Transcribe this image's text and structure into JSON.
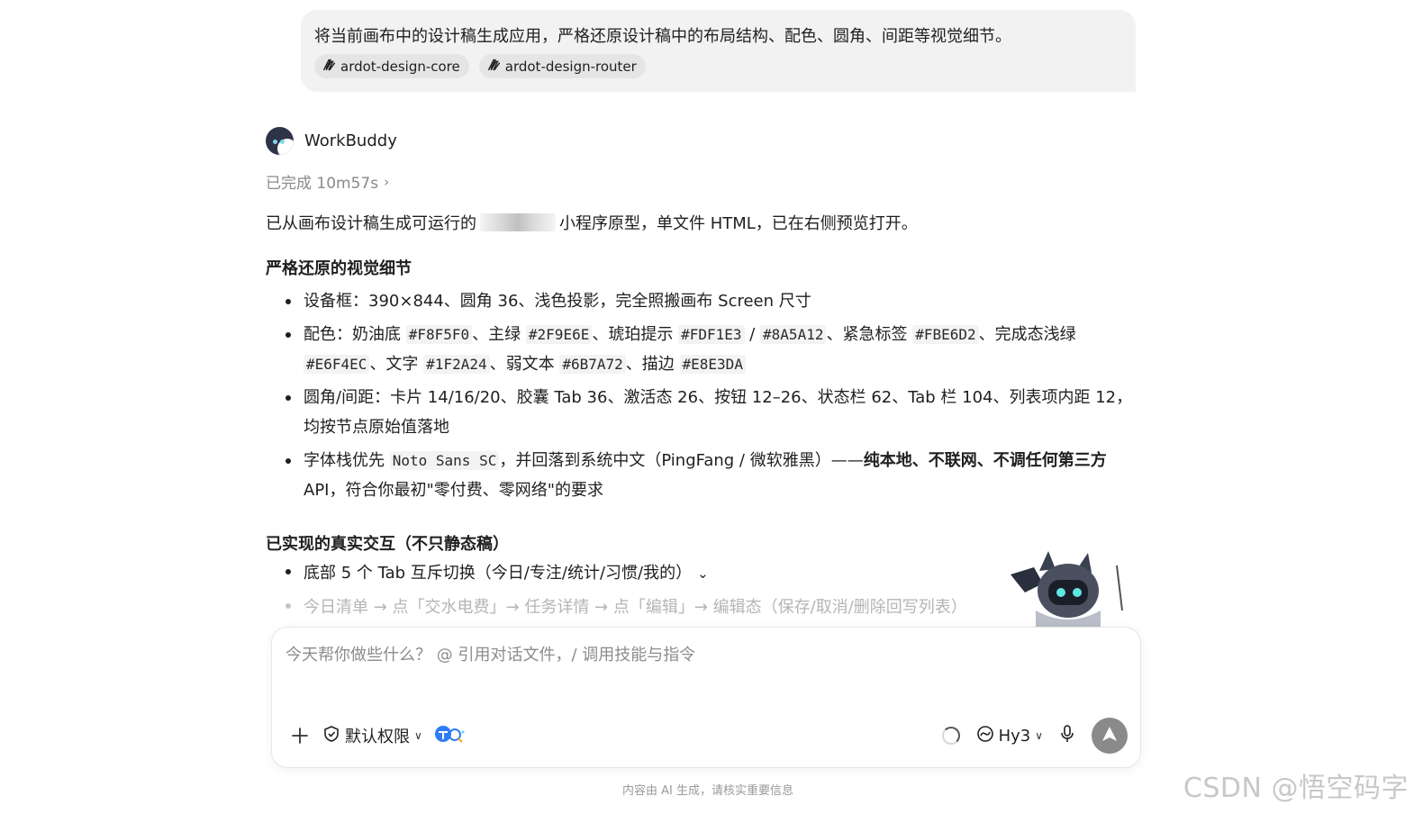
{
  "user_message": {
    "text": "将当前画布中的设计稿生成应用，严格还原设计稿中的布局结构、配色、圆角、间距等视觉细节。",
    "chips": [
      "ardot-design-core",
      "ardot-design-router"
    ]
  },
  "assistant": {
    "name": "WorkBuddy",
    "status": "已完成 10m57s",
    "intro_before": "已从画布设计稿生成可运行的",
    "intro_after": "小程序原型，单文件 HTML，已在右侧预览打开。",
    "section1_title": "严格还原的视觉细节",
    "b1": "设备框：390×844、圆角 36、浅色投影，完全照搬画布 Screen 尺寸",
    "b2": {
      "p1": "配色：奶油底 ",
      "c1": "#F8F5F0",
      "p2": "、主绿 ",
      "c2": "#2F9E6E",
      "p3": "、琥珀提示 ",
      "c3": "#FDF1E3",
      "p4": " / ",
      "c4": "#8A5A12",
      "p5": "、紧急标签 ",
      "c5": "#FBE6D2",
      "p6": "、完成态浅绿 ",
      "c6": "#E6F4EC",
      "p7": "、文字 ",
      "c7": "#1F2A24",
      "p8": "、弱文本 ",
      "c8": "#6B7A72",
      "p9": "、描边 ",
      "c9": "#E8E3DA"
    },
    "b3": "圆角/间距：卡片 14/16/20、胶囊 Tab 36、激活态 26、按钮 12–26、状态栏 62、Tab 栏 104、列表项内距 12，均按节点原始值落地",
    "b4": {
      "p1": "字体栈优先 ",
      "c1": "Noto Sans SC",
      "p2": "，并回落到系统中文（PingFang / 微软雅黑）——",
      "strong": "纯本地、不联网、不调任何第三方",
      "p3": "API，符合你最初\"零付费、零网络\"的要求"
    },
    "section2_title": "已实现的真实交互（不只静态稿）",
    "s2b1": "底部 5 个 Tab 互斥切换（今日/专注/统计/习惯/我的）",
    "s2b2": "今日清单 → 点「交水电费」→ 任务详情 → 点「编辑」→ 编辑态（保存/取消/删除回写列表）"
  },
  "composer": {
    "placeholder": "今天帮你做些什么？ @ 引用对话文件，/ 调用技能与指令",
    "permission": "默认权限",
    "model": "Hy3"
  },
  "footer": {
    "disclaimer": "内容由 AI 生成，请核实重要信息",
    "watermark": "CSDN @悟空码字"
  },
  "colors": {
    "bubble_bg": "#F2F2F2",
    "send_button": "#8A8A8A"
  },
  "icons": [
    "skill-chip-icon",
    "shield-check-icon",
    "agent-icon",
    "spinner-icon",
    "model-icon",
    "mic-icon",
    "send-arrow-icon",
    "chevron-right-icon",
    "chevron-down-icon",
    "plus-icon"
  ]
}
